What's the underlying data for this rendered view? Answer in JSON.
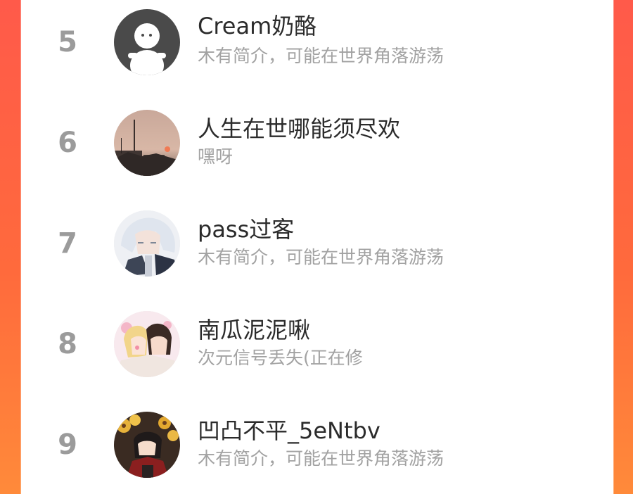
{
  "list": {
    "items": [
      {
        "rank": "5",
        "name": "Cream奶酪",
        "bio": "木有简介，可能在世界角落游荡",
        "avatar": "default-avatar-icon"
      },
      {
        "rank": "6",
        "name": "人生在世哪能须尽欢",
        "bio": "嘿呀",
        "avatar": "sunset-street-photo"
      },
      {
        "rank": "7",
        "name": "pass过客",
        "bio": "木有简介，可能在世界角落游荡",
        "avatar": "anime-white-hair-character"
      },
      {
        "rank": "8",
        "name": "南瓜泥泥啾",
        "bio": "次元信号丢失(正在修",
        "avatar": "anime-couple-hugging"
      },
      {
        "rank": "9",
        "name": "凹凸不平_5eNtbv",
        "bio": "木有简介，可能在世界角落游荡",
        "avatar": "anime-character-sunflowers"
      }
    ]
  },
  "colors": {
    "background_gradient_start": "#ff5a4a",
    "background_gradient_end": "#ff8a3a",
    "rank_text": "#9b9b9b",
    "name_text": "#2b2b2b",
    "bio_text": "#a2a2a2"
  }
}
